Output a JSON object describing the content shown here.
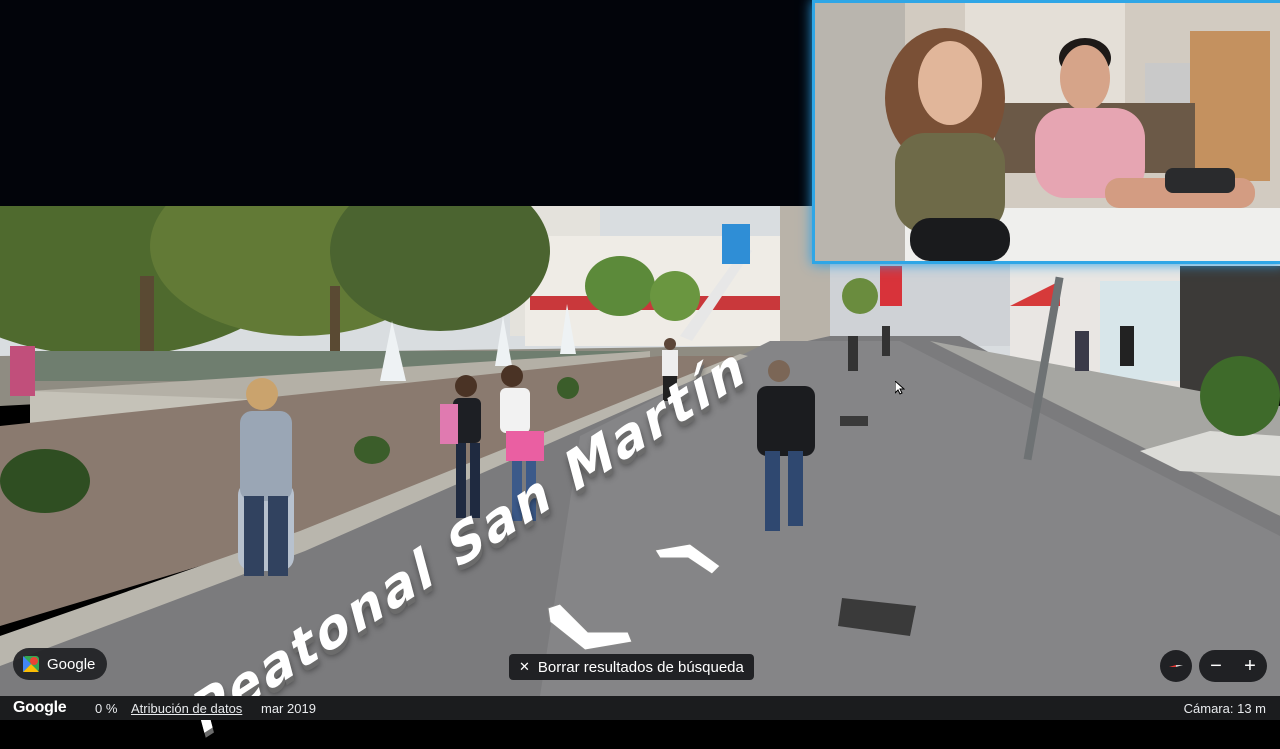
{
  "map": {
    "street_label": "Peatonal San Martín"
  },
  "controls": {
    "google_label": "Google",
    "clear_search_label": "Borrar resultados de búsqueda",
    "zoom_out": "−",
    "zoom_in": "+"
  },
  "footer": {
    "logo": "Google",
    "progress": "0 %",
    "attribution": "Atribución de datos",
    "date": "mar 2019",
    "camera": "Cámara: 13 m"
  },
  "icons": {
    "google_app": "google-maps-pin-icon",
    "clear": "close-icon",
    "compass": "compass-icon",
    "nav_forward": "chevron-up-icon",
    "nav_back": "chevron-down-icon",
    "pointer": "mouse-cursor-icon"
  }
}
